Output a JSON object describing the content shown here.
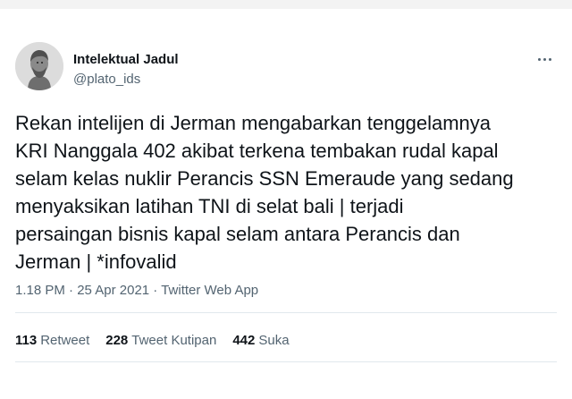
{
  "tweet": {
    "author": {
      "name": "Intelektual Jadul",
      "handle": "@plato_ids",
      "avatar_icon": "statue-bust-avatar"
    },
    "more_icon": "more-horizontal-icon",
    "text_lines": [
      "Rekan intelijen di Jerman mengabarkan tenggelamnya",
      "KRI Nanggala 402 akibat terkena tembakan rudal kapal",
      "selam kelas nuklir Perancis SSN Emeraude yang sedang",
      "menyaksikan latihan TNI di selat bali | terjadi",
      "persaingan bisnis kapal selam antara Perancis dan",
      "Jerman | *infovalid"
    ],
    "meta": {
      "time": "1.18 PM",
      "separator": "·",
      "date": "25 Apr 2021",
      "app": "Twitter Web App"
    },
    "stats": [
      {
        "count": "113",
        "label": "Retweet"
      },
      {
        "count": "228",
        "label": "Tweet Kutipan"
      },
      {
        "count": "442",
        "label": "Suka"
      }
    ]
  },
  "colors": {
    "text": "#0f1419",
    "secondary": "#536471",
    "divider": "#e1e8ed",
    "background": "#ffffff"
  }
}
